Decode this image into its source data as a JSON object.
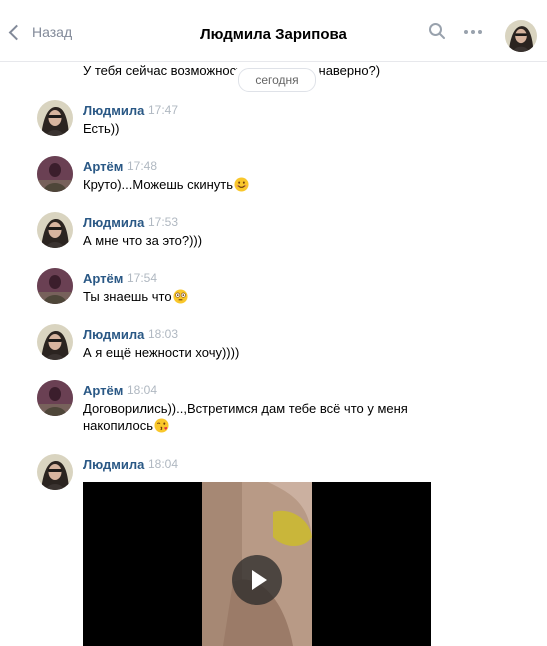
{
  "header": {
    "back_label": "Назад",
    "title": "Людмила Зарипова"
  },
  "previous_message": "У тебя сейчас возможност… …то нету наверно?)",
  "date_divider": "сегодня",
  "messages": [
    {
      "author": "Людмила",
      "time": "17:47",
      "text": "Есть))"
    },
    {
      "author": "Артём",
      "time": "17:48",
      "text": "Круто)...Можешь скинуть",
      "emoji": "smile"
    },
    {
      "author": "Людмила",
      "time": "17:53",
      "text": "А мне что за это?)))"
    },
    {
      "author": "Артём",
      "time": "17:54",
      "text": "Ты знаешь что",
      "emoji": "flushed"
    },
    {
      "author": "Людмила",
      "time": "18:03",
      "text": "А я ещё нежности хочу))))"
    },
    {
      "author": "Артём",
      "time": "18:04",
      "text": "Договорились))..,Встретимся дам тебе всё что у меня накопилось",
      "emoji": "kiss"
    },
    {
      "author": "Людмила",
      "time": "18:04",
      "attachment": "video"
    }
  ],
  "colors": {
    "author_name": "#2a5885",
    "timestamp": "#b0b8c1",
    "divider": "#e7e8ec",
    "header_icons": "#828a99"
  },
  "icons": [
    "chevron-left-icon",
    "search-icon",
    "more-dots-icon",
    "play-icon"
  ]
}
